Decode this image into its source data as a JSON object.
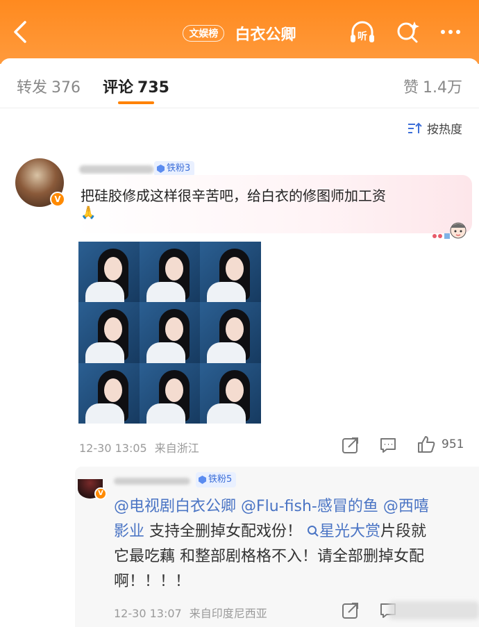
{
  "header": {
    "badge": "文娱榜",
    "title": "白衣公卿",
    "back_icon": "chevron-left-icon",
    "listen_icon": "headphones-icon",
    "listen_label": "听",
    "search_icon": "search-sparkle-icon",
    "more_icon": "more-dots-icon",
    "colors": {
      "bar": "#ff8a1f"
    }
  },
  "tabs": {
    "repost": {
      "label": "转发",
      "count": "376"
    },
    "comments": {
      "label": "评论",
      "count": "735"
    },
    "likes": {
      "label": "赞",
      "count": "1.4万"
    },
    "accent": "#ff8200"
  },
  "sort": {
    "label": "按热度",
    "icon": "sort-icon"
  },
  "comments": [
    {
      "fan_badge": "铁粉3",
      "verified": "V",
      "text": "把硅胶修成这样很辛苦吧，给白衣的修图师加工资",
      "emoji": "🙏",
      "time": "12-30 13:05",
      "source": "来自浙江",
      "likes": "951"
    }
  ],
  "reply": {
    "fan_badge": "铁粉5",
    "verified": "V",
    "mention1": "@电视剧白衣公卿",
    "mention2": "@Flu-fish-感冒的鱼",
    "mention3": "@西嘻",
    "mention3b": "影业",
    "text1": " 支持全删掉女配戏份！",
    "search_link": "星光大赏",
    "text2": "片段就",
    "text3": "它最吃藕 和整部剧格格不入！请全部删掉女配",
    "text4": "啊！！！！",
    "time": "12-30 13:07",
    "source": "来自印度尼西亚"
  }
}
